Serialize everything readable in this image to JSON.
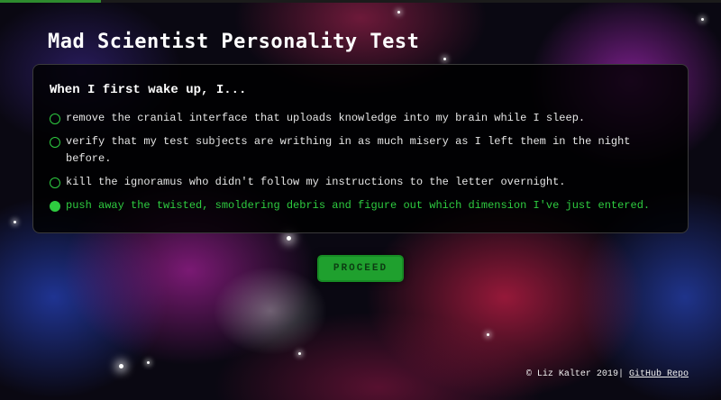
{
  "progress": {
    "fraction": 0.14
  },
  "page_title": "Mad Scientist Personality Test",
  "quiz": {
    "question": "When I first wake up, I...",
    "answers": [
      {
        "text": "remove the cranial interface that uploads knowledge into my brain while I sleep.",
        "selected": false
      },
      {
        "text": "verify that my test subjects are writhing in as much misery as I left them in the night before.",
        "selected": false
      },
      {
        "text": "kill the ignoramus who didn't follow my instructions to the letter overnight.",
        "selected": false
      },
      {
        "text": "push away the twisted, smoldering debris and figure out which dimension I've just entered.",
        "selected": true
      }
    ],
    "proceed_label": "PROCEED"
  },
  "footer": {
    "copyright": "© Liz Kalter 2019",
    "separator": "|",
    "repo_link": "GitHub Repo"
  },
  "colors": {
    "accent": "#2ecc40",
    "button": "#1fa02e",
    "progress": "#2e8b2e"
  }
}
